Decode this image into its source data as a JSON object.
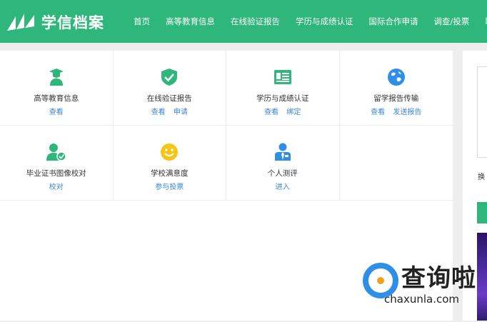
{
  "header": {
    "logo_text": "学信档案",
    "nav": [
      "首页",
      "高等教育信息",
      "在线验证报告",
      "学历与成绩认证",
      "国际合作申请",
      "调查/投票",
      "职业"
    ]
  },
  "grid": {
    "rows": [
      [
        {
          "icon": "graduate-icon",
          "title": "高等教育信息",
          "links": [
            "查看"
          ]
        },
        {
          "icon": "shield-check-icon",
          "title": "在线验证报告",
          "links": [
            "查看",
            "申请"
          ]
        },
        {
          "icon": "certificate-icon",
          "title": "学历与成绩认证",
          "links": [
            "查看",
            "绑定"
          ]
        },
        {
          "icon": "globe-icon",
          "title": "留学报告传输",
          "links": [
            "查看",
            "发送报告"
          ]
        }
      ],
      [
        {
          "icon": "user-check-icon",
          "title": "毕业证书图像校对",
          "links": [
            "校对"
          ]
        },
        {
          "icon": "smiley-icon",
          "title": "学校满意度",
          "links": [
            "参与投票"
          ]
        },
        {
          "icon": "person-tie-icon",
          "title": "个人测评",
          "links": [
            "进入"
          ]
        },
        null
      ]
    ]
  },
  "side": {
    "text": "换"
  },
  "watermark": {
    "title": "查询啦",
    "url": "chaxunla.com"
  },
  "colors": {
    "brand": "#2eb67b",
    "link": "#3b87d8",
    "icon_blue": "#2f8fe8",
    "icon_yellow": "#f5c518"
  }
}
